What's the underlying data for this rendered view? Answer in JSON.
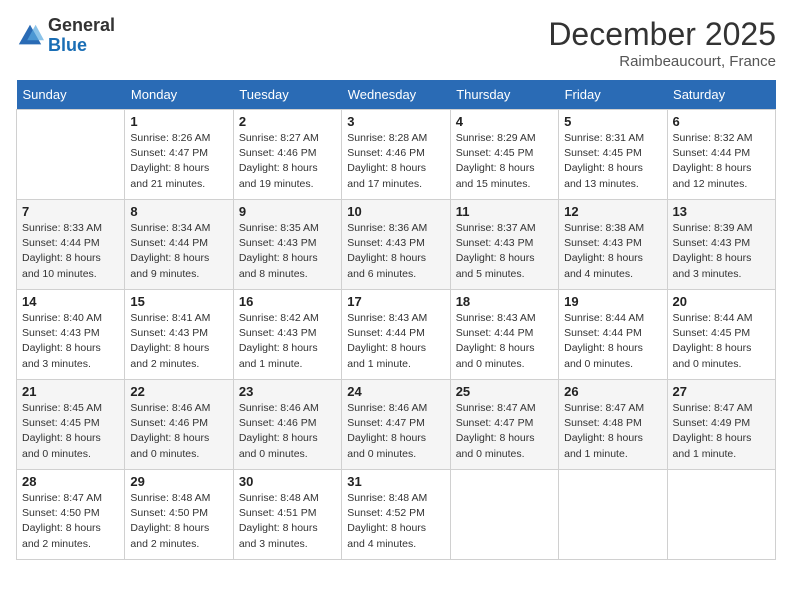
{
  "header": {
    "logo_general": "General",
    "logo_blue": "Blue",
    "month_title": "December 2025",
    "location": "Raimbeaucourt, France"
  },
  "days_of_week": [
    "Sunday",
    "Monday",
    "Tuesday",
    "Wednesday",
    "Thursday",
    "Friday",
    "Saturday"
  ],
  "weeks": [
    [
      {
        "day": "",
        "info": ""
      },
      {
        "day": "1",
        "info": "Sunrise: 8:26 AM\nSunset: 4:47 PM\nDaylight: 8 hours\nand 21 minutes."
      },
      {
        "day": "2",
        "info": "Sunrise: 8:27 AM\nSunset: 4:46 PM\nDaylight: 8 hours\nand 19 minutes."
      },
      {
        "day": "3",
        "info": "Sunrise: 8:28 AM\nSunset: 4:46 PM\nDaylight: 8 hours\nand 17 minutes."
      },
      {
        "day": "4",
        "info": "Sunrise: 8:29 AM\nSunset: 4:45 PM\nDaylight: 8 hours\nand 15 minutes."
      },
      {
        "day": "5",
        "info": "Sunrise: 8:31 AM\nSunset: 4:45 PM\nDaylight: 8 hours\nand 13 minutes."
      },
      {
        "day": "6",
        "info": "Sunrise: 8:32 AM\nSunset: 4:44 PM\nDaylight: 8 hours\nand 12 minutes."
      }
    ],
    [
      {
        "day": "7",
        "info": "Sunrise: 8:33 AM\nSunset: 4:44 PM\nDaylight: 8 hours\nand 10 minutes."
      },
      {
        "day": "8",
        "info": "Sunrise: 8:34 AM\nSunset: 4:44 PM\nDaylight: 8 hours\nand 9 minutes."
      },
      {
        "day": "9",
        "info": "Sunrise: 8:35 AM\nSunset: 4:43 PM\nDaylight: 8 hours\nand 8 minutes."
      },
      {
        "day": "10",
        "info": "Sunrise: 8:36 AM\nSunset: 4:43 PM\nDaylight: 8 hours\nand 6 minutes."
      },
      {
        "day": "11",
        "info": "Sunrise: 8:37 AM\nSunset: 4:43 PM\nDaylight: 8 hours\nand 5 minutes."
      },
      {
        "day": "12",
        "info": "Sunrise: 8:38 AM\nSunset: 4:43 PM\nDaylight: 8 hours\nand 4 minutes."
      },
      {
        "day": "13",
        "info": "Sunrise: 8:39 AM\nSunset: 4:43 PM\nDaylight: 8 hours\nand 3 minutes."
      }
    ],
    [
      {
        "day": "14",
        "info": "Sunrise: 8:40 AM\nSunset: 4:43 PM\nDaylight: 8 hours\nand 3 minutes."
      },
      {
        "day": "15",
        "info": "Sunrise: 8:41 AM\nSunset: 4:43 PM\nDaylight: 8 hours\nand 2 minutes."
      },
      {
        "day": "16",
        "info": "Sunrise: 8:42 AM\nSunset: 4:43 PM\nDaylight: 8 hours\nand 1 minute."
      },
      {
        "day": "17",
        "info": "Sunrise: 8:43 AM\nSunset: 4:44 PM\nDaylight: 8 hours\nand 1 minute."
      },
      {
        "day": "18",
        "info": "Sunrise: 8:43 AM\nSunset: 4:44 PM\nDaylight: 8 hours\nand 0 minutes."
      },
      {
        "day": "19",
        "info": "Sunrise: 8:44 AM\nSunset: 4:44 PM\nDaylight: 8 hours\nand 0 minutes."
      },
      {
        "day": "20",
        "info": "Sunrise: 8:44 AM\nSunset: 4:45 PM\nDaylight: 8 hours\nand 0 minutes."
      }
    ],
    [
      {
        "day": "21",
        "info": "Sunrise: 8:45 AM\nSunset: 4:45 PM\nDaylight: 8 hours\nand 0 minutes."
      },
      {
        "day": "22",
        "info": "Sunrise: 8:46 AM\nSunset: 4:46 PM\nDaylight: 8 hours\nand 0 minutes."
      },
      {
        "day": "23",
        "info": "Sunrise: 8:46 AM\nSunset: 4:46 PM\nDaylight: 8 hours\nand 0 minutes."
      },
      {
        "day": "24",
        "info": "Sunrise: 8:46 AM\nSunset: 4:47 PM\nDaylight: 8 hours\nand 0 minutes."
      },
      {
        "day": "25",
        "info": "Sunrise: 8:47 AM\nSunset: 4:47 PM\nDaylight: 8 hours\nand 0 minutes."
      },
      {
        "day": "26",
        "info": "Sunrise: 8:47 AM\nSunset: 4:48 PM\nDaylight: 8 hours\nand 1 minute."
      },
      {
        "day": "27",
        "info": "Sunrise: 8:47 AM\nSunset: 4:49 PM\nDaylight: 8 hours\nand 1 minute."
      }
    ],
    [
      {
        "day": "28",
        "info": "Sunrise: 8:47 AM\nSunset: 4:50 PM\nDaylight: 8 hours\nand 2 minutes."
      },
      {
        "day": "29",
        "info": "Sunrise: 8:48 AM\nSunset: 4:50 PM\nDaylight: 8 hours\nand 2 minutes."
      },
      {
        "day": "30",
        "info": "Sunrise: 8:48 AM\nSunset: 4:51 PM\nDaylight: 8 hours\nand 3 minutes."
      },
      {
        "day": "31",
        "info": "Sunrise: 8:48 AM\nSunset: 4:52 PM\nDaylight: 8 hours\nand 4 minutes."
      },
      {
        "day": "",
        "info": ""
      },
      {
        "day": "",
        "info": ""
      },
      {
        "day": "",
        "info": ""
      }
    ]
  ]
}
